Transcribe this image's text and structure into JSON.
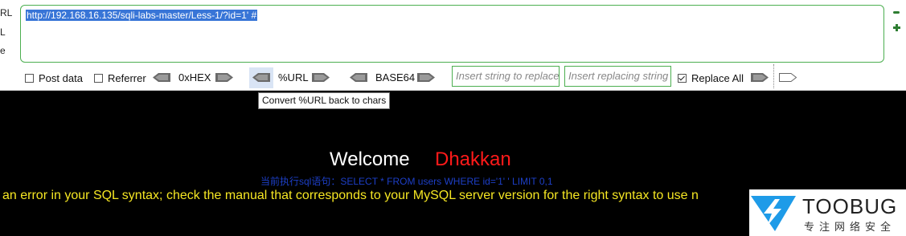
{
  "hackbar": {
    "side_labels": [
      "RL",
      "L",
      "e"
    ],
    "url": "http://192.168.16.135/sqli-labs-master/Less-1/?id=1' #",
    "post_data_label": "Post data",
    "referrer_label": "Referrer",
    "hex_label": "0xHEX",
    "url_label": "%URL",
    "base64_label": "BASE64",
    "insert_placeholder": "Insert string to replace",
    "replacing_placeholder": "Insert replacing string",
    "replace_all_label": "Replace All",
    "post_data_checked": false,
    "referrer_checked": false,
    "replace_all_checked": true
  },
  "tooltip": "Convert %URL back to chars",
  "page": {
    "welcome": "Welcome",
    "name": "Dhakkan",
    "sql": "当前执行sql语句：SELECT * FROM users WHERE id='1' ' LIMIT 0,1",
    "error": "an error in your SQL syntax; check the manual that corresponds to your MySQL server version for the right syntax to use n"
  },
  "watermark": {
    "name": "TOOBUG",
    "subtitle": "专注网络安全"
  },
  "colors": {
    "accent_green": "#4caf50",
    "selection": "#3875d7",
    "welcome_name": "#ff1a1a",
    "sql_text": "#1d3fc7",
    "error_text": "#f5e623",
    "logo_blue": "#1e9be8"
  }
}
